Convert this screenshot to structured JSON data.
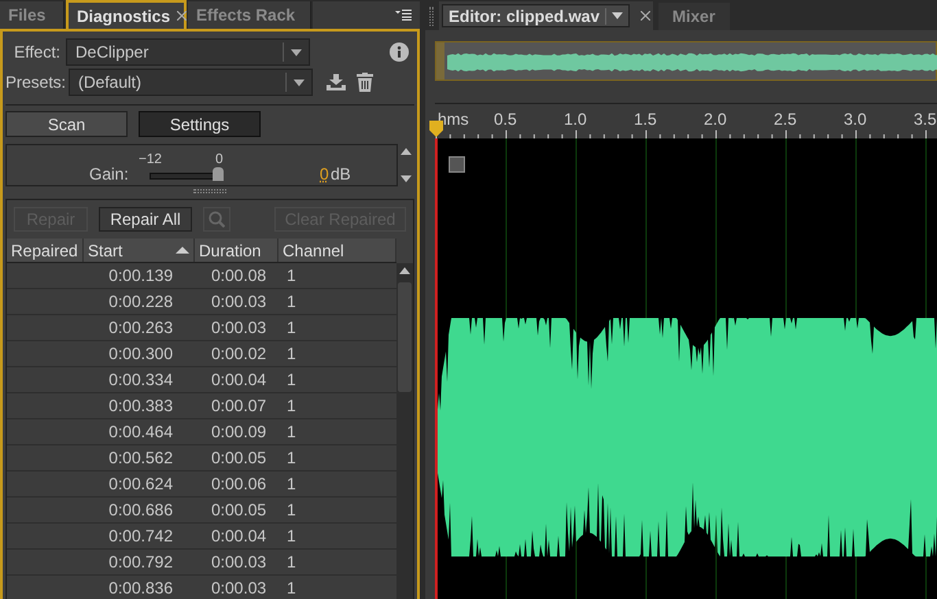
{
  "left_tabs": [
    {
      "label": "Files",
      "selected": false
    },
    {
      "label": "Diagnostics",
      "selected": true
    },
    {
      "label": "Effects Rack",
      "selected": false
    }
  ],
  "effect": {
    "label": "Effect:",
    "value": "DeClipper"
  },
  "presets": {
    "label": "Presets:",
    "value": "(Default)"
  },
  "mode_buttons": [
    {
      "label": "Scan",
      "selected": false
    },
    {
      "label": "Settings",
      "selected": true
    }
  ],
  "gain": {
    "label": "Gain:",
    "min_label": "−12",
    "max_label": "0",
    "level": 1,
    "reading": "0",
    "unit": "dB"
  },
  "actions": [
    {
      "kind": "text",
      "label": "Repair",
      "disabled": true
    },
    {
      "kind": "text",
      "label": "Repair All",
      "disabled": false
    },
    {
      "kind": "search",
      "disabled": true
    },
    {
      "kind": "text",
      "label": "Clear Repaired",
      "disabled": true
    }
  ],
  "table": {
    "columns": [
      {
        "label": "Repaired",
        "sorted": false
      },
      {
        "label": "Start",
        "sorted": true
      },
      {
        "label": "Duration",
        "sorted": false
      },
      {
        "label": "Channel",
        "sorted": false
      }
    ],
    "rows": [
      {
        "start": "0:00.139",
        "duration": "0:00.08",
        "channel": "1"
      },
      {
        "start": "0:00.228",
        "duration": "0:00.03",
        "channel": "1"
      },
      {
        "start": "0:00.263",
        "duration": "0:00.03",
        "channel": "1"
      },
      {
        "start": "0:00.300",
        "duration": "0:00.02",
        "channel": "1"
      },
      {
        "start": "0:00.334",
        "duration": "0:00.04",
        "channel": "1"
      },
      {
        "start": "0:00.383",
        "duration": "0:00.07",
        "channel": "1"
      },
      {
        "start": "0:00.464",
        "duration": "0:00.09",
        "channel": "1"
      },
      {
        "start": "0:00.562",
        "duration": "0:00.05",
        "channel": "1"
      },
      {
        "start": "0:00.624",
        "duration": "0:00.06",
        "channel": "1"
      },
      {
        "start": "0:00.686",
        "duration": "0:00.05",
        "channel": "1"
      },
      {
        "start": "0:00.742",
        "duration": "0:00.04",
        "channel": "1"
      },
      {
        "start": "0:00.792",
        "duration": "0:00.03",
        "channel": "1"
      },
      {
        "start": "0:00.836",
        "duration": "0:00.03",
        "channel": "1"
      }
    ]
  },
  "right_tabs": [
    {
      "label": "Editor: clipped.wav",
      "selected": true
    },
    {
      "label": "Mixer",
      "selected": false
    }
  ],
  "ruler": {
    "unit": "hms",
    "ticks": [
      "0.5",
      "1.0",
      "1.5",
      "2.0",
      "2.5",
      "3.0",
      "3.5"
    ]
  }
}
